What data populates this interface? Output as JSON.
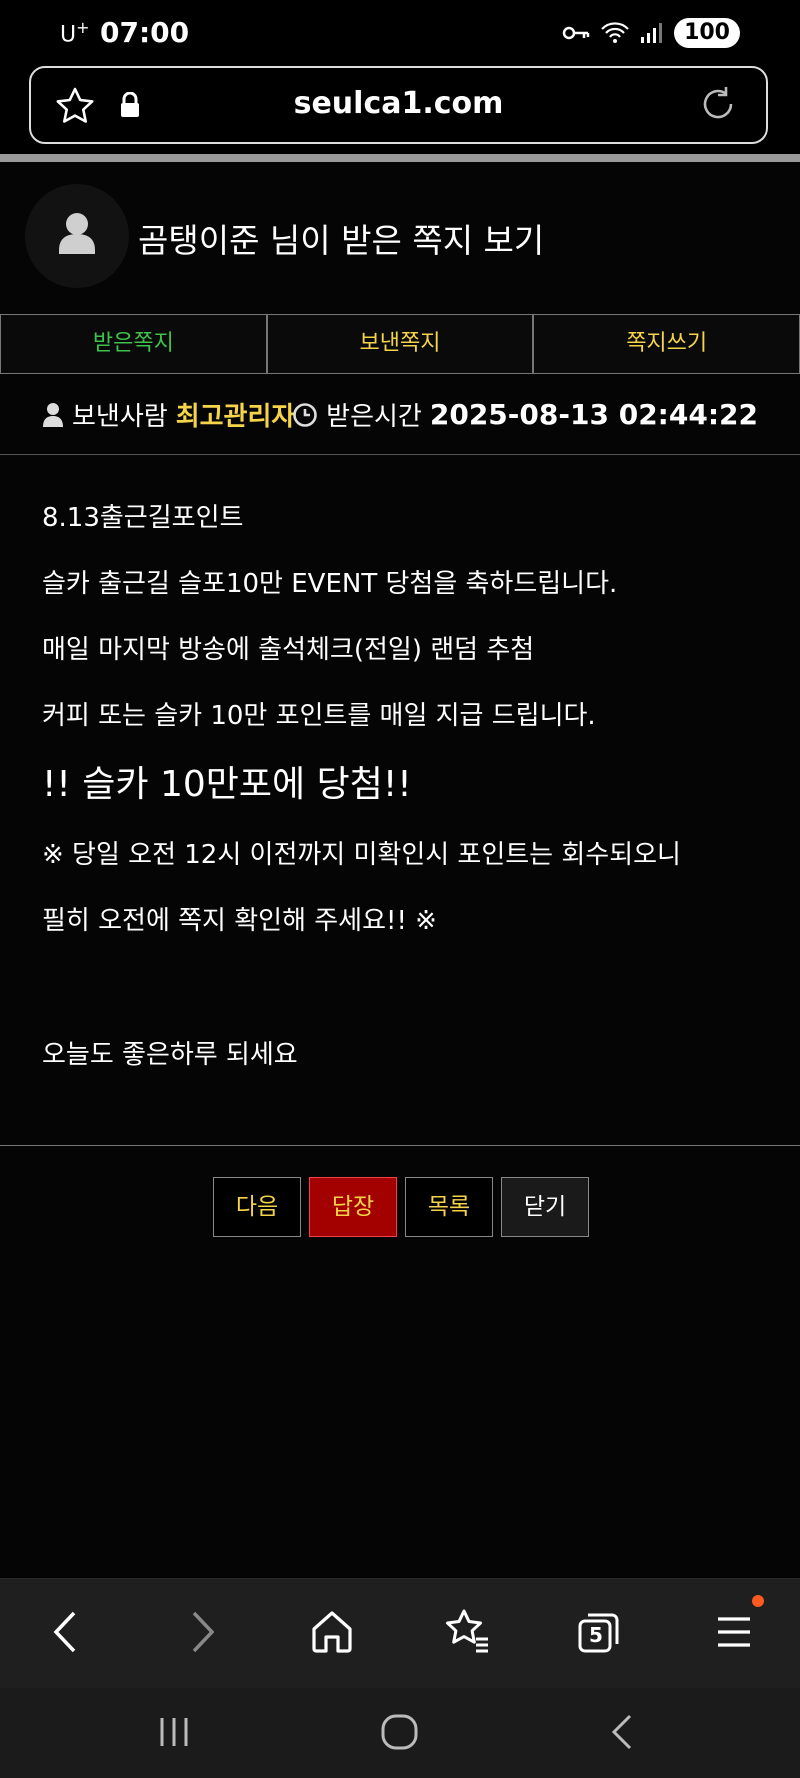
{
  "status_bar": {
    "carrier": "U",
    "carrier_sup": "+",
    "time": "07:00",
    "battery": "100"
  },
  "browser": {
    "url": "seulca1.com"
  },
  "page": {
    "title": "곰탱이준 님이 받은 쪽지 보기",
    "tabs": [
      {
        "label": "받은쪽지"
      },
      {
        "label": "보낸쪽지"
      },
      {
        "label": "쪽지쓰기"
      }
    ],
    "meta": {
      "sender_label": "보낸사람",
      "sender": "최고관리자",
      "time_label": "받은시간",
      "time": "2025-08-13 02:44:22"
    },
    "message_lines": [
      "8.13출근길포인트",
      "슬카 출근길 슬포10만 EVENT 당첨을 축하드립니다.",
      "매일 마지막 방송에 출석체크(전일) 랜덤 추첨",
      "커피 또는 슬카 10만 포인트를 매일 지급 드립니다.",
      "!! 슬카 10만포에 당첨!!",
      "※ 당일 오전 12시 이전까지 미확인시 포인트는 회수되오니",
      "필히 오전에 쪽지 확인해 주세요!! ※",
      "오늘도 좋은하루 되세요"
    ],
    "buttons": {
      "next": "다음",
      "reply": "답장",
      "list": "목록",
      "close": "닫기"
    }
  },
  "bottom_nav": {
    "tab_count": "5"
  },
  "colors": {
    "active_tab": "#3ec24a",
    "highlight": "#f5d44a",
    "reply_bg": "#a30000"
  }
}
